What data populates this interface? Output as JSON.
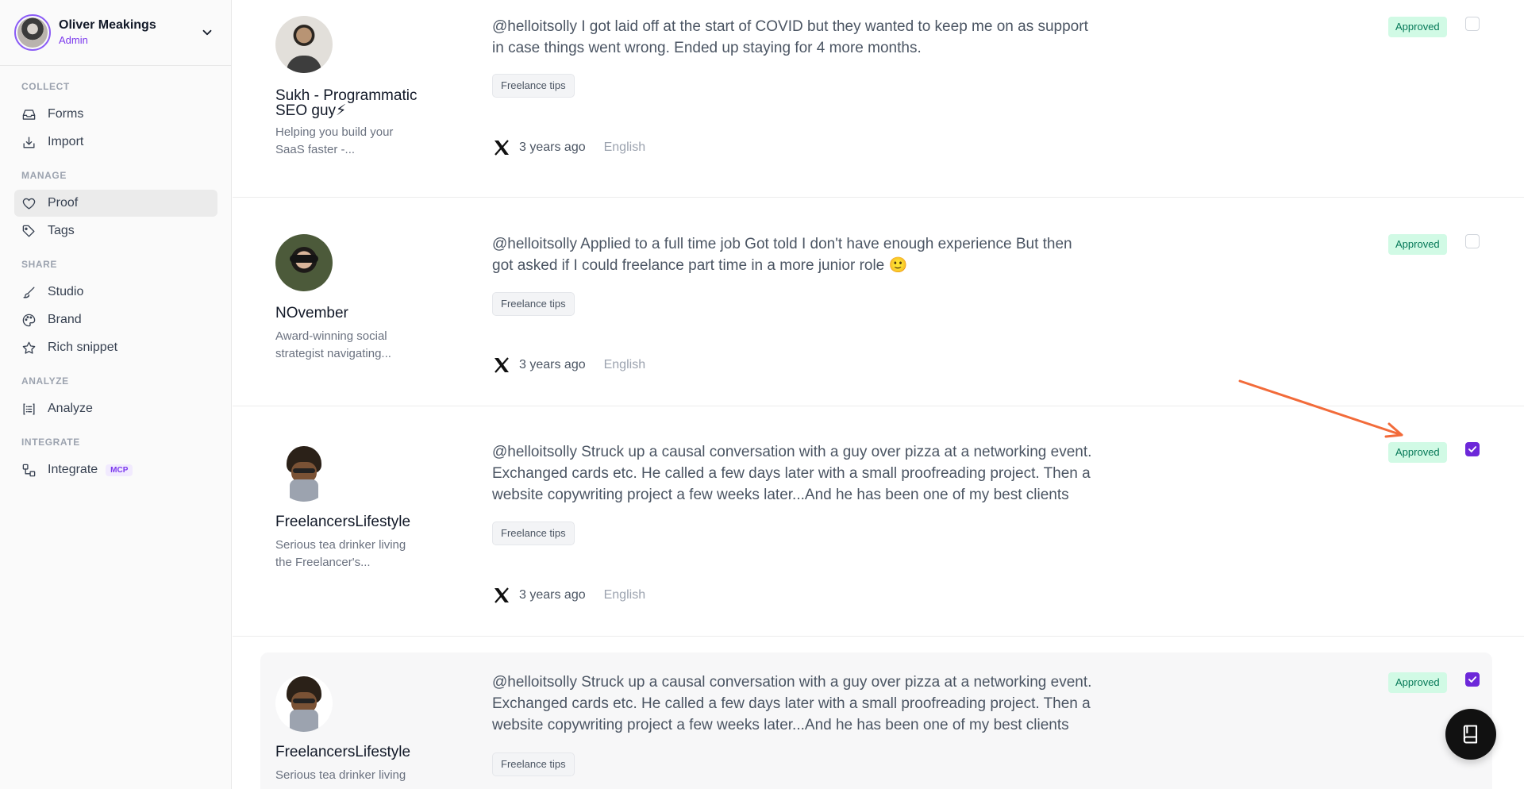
{
  "user": {
    "name": "Oliver Meakings",
    "role": "Admin"
  },
  "sidebar": {
    "sections": [
      {
        "title": "COLLECT",
        "items": [
          {
            "label": "Forms",
            "icon": "inbox-icon"
          },
          {
            "label": "Import",
            "icon": "import-icon"
          }
        ]
      },
      {
        "title": "MANAGE",
        "items": [
          {
            "label": "Proof",
            "icon": "heart-icon",
            "active": true
          },
          {
            "label": "Tags",
            "icon": "tag-icon"
          }
        ]
      },
      {
        "title": "SHARE",
        "items": [
          {
            "label": "Studio",
            "icon": "brush-icon"
          },
          {
            "label": "Brand",
            "icon": "palette-icon"
          },
          {
            "label": "Rich snippet",
            "icon": "star-icon"
          }
        ]
      },
      {
        "title": "ANALYZE",
        "items": [
          {
            "label": "Analyze",
            "icon": "list-icon"
          }
        ]
      },
      {
        "title": "INTEGRATE",
        "items": [
          {
            "label": "Integrate",
            "icon": "integrate-icon",
            "badge": "MCP"
          }
        ]
      }
    ]
  },
  "testimonials": [
    {
      "name": "Sukh - Programmatic SEO guy⚡",
      "bio": "Helping you build your SaaS faster -...",
      "text": "@helloitsolly I got laid off at the start of COVID but they wanted to keep me on as support in case things went wrong. Ended up staying for 4 more months.",
      "tag": "Freelance tips",
      "source_icon": "x-logo-icon",
      "time": "3 years ago",
      "language": "English",
      "status": "Approved",
      "checked": false
    },
    {
      "name": "NOvember",
      "bio": "Award-winning social strategist navigating...",
      "text": "@helloitsolly Applied to a full time job Got told I don't have enough experience But then got asked if I could freelance part time in a more junior role 🙂",
      "tag": "Freelance tips",
      "source_icon": "x-logo-icon",
      "time": "3 years ago",
      "language": "English",
      "status": "Approved",
      "checked": false
    },
    {
      "name": "FreelancersLifestyle",
      "bio": "Serious tea drinker living the Freelancer's...",
      "text": "@helloitsolly Struck up a causal conversation with a guy over pizza at a networking event. Exchanged cards etc. He called a few days later with a small proofreading project. Then a website copywriting project a few weeks later...And he has been one of my best clients fo...",
      "tag": "Freelance tips",
      "source_icon": "x-logo-icon",
      "time": "3 years ago",
      "language": "English",
      "status": "Approved",
      "checked": true
    },
    {
      "name": "FreelancersLifestyle",
      "bio": "Serious tea drinker living",
      "text": "@helloitsolly Struck up a causal conversation with a guy over pizza at a networking event. Exchanged cards etc. He called a few days later with a small proofreading project. Then a website copywriting project a few weeks later...And he has been one of my best clients fo...",
      "tag": "Freelance tips",
      "status": "Approved",
      "checked": true
    }
  ],
  "colors": {
    "accent": "#6d28d9",
    "approved_bg": "#d1fae5",
    "approved_text": "#047857",
    "annotation_arrow": "#f26b3a"
  },
  "fab_icon": "book-icon"
}
